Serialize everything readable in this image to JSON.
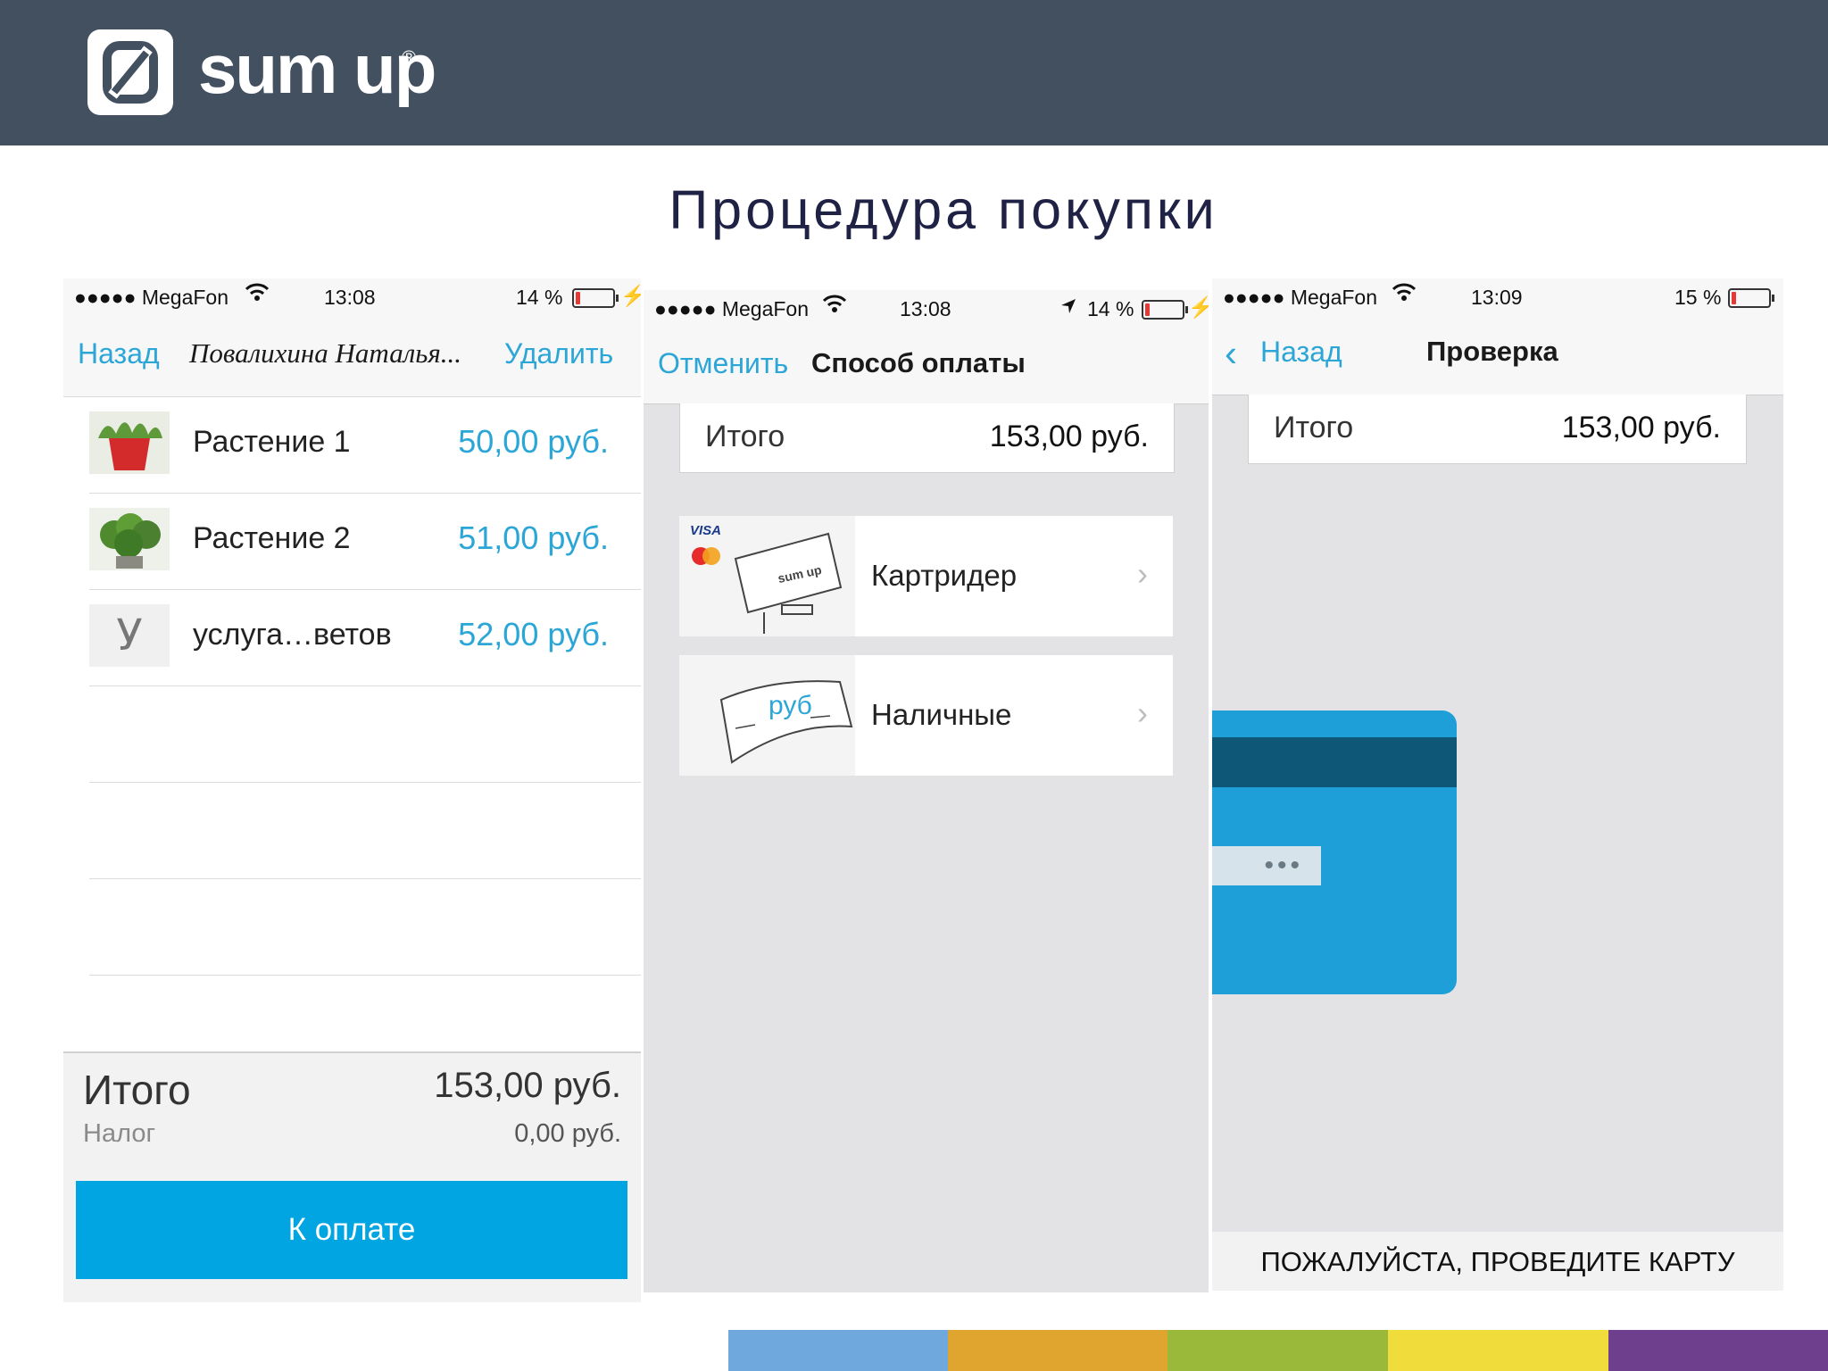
{
  "brand": {
    "name": "sum up",
    "registered": "®"
  },
  "page_title": "Процедура покупки",
  "colors": {
    "header_bg": "#435060",
    "accent": "#2ba6d6",
    "button": "#00a5e1",
    "title": "#1f2145",
    "stripes": [
      "#6fa8dc",
      "#e0a52e",
      "#9ab93a",
      "#f0dc3a",
      "#6e3f8d"
    ]
  },
  "cart": {
    "status": {
      "carrier": "●●●●● MegaFon",
      "time": "13:08",
      "battery": "14 %"
    },
    "nav": {
      "back": "Назад",
      "title": "Повалихина Наталья...",
      "delete": "Удалить"
    },
    "items": [
      {
        "name": "Растение 1",
        "price": "50,00 руб.",
        "thumb": "plant-1-photo"
      },
      {
        "name": "Растение 2",
        "price": "51,00 руб.",
        "thumb": "plant-2-photo"
      },
      {
        "name": "услуга…ветов",
        "price": "52,00 руб.",
        "thumb_letter": "У"
      }
    ],
    "total_label": "Итого",
    "total_value": "153,00 руб.",
    "tax_label": "Налог",
    "tax_value": "0,00 руб.",
    "pay_button": "К оплате"
  },
  "payment": {
    "status": {
      "carrier": "●●●●● MegaFon",
      "time": "13:08",
      "battery": "14 %"
    },
    "nav": {
      "cancel": "Отменить",
      "title": "Способ оплаты"
    },
    "total_label": "Итого",
    "total_value": "153,00 руб.",
    "methods": [
      {
        "label": "Картридер",
        "icon": "card-reader-icon",
        "visa": "VISA",
        "reader_logo": "sum up"
      },
      {
        "label": "Наличные",
        "icon": "cash-note-icon",
        "note_text": "руб"
      }
    ]
  },
  "check": {
    "status": {
      "carrier": "●●●●● MegaFon",
      "time": "13:09",
      "battery": "15 %"
    },
    "nav": {
      "back": "Назад",
      "title": "Проверка"
    },
    "total_label": "Итого",
    "total_value": "153,00 руб.",
    "card_dots": "•••",
    "swipe_prompt": "ПОЖАЛУЙСТА, ПРОВЕДИТЕ КАРТУ"
  }
}
